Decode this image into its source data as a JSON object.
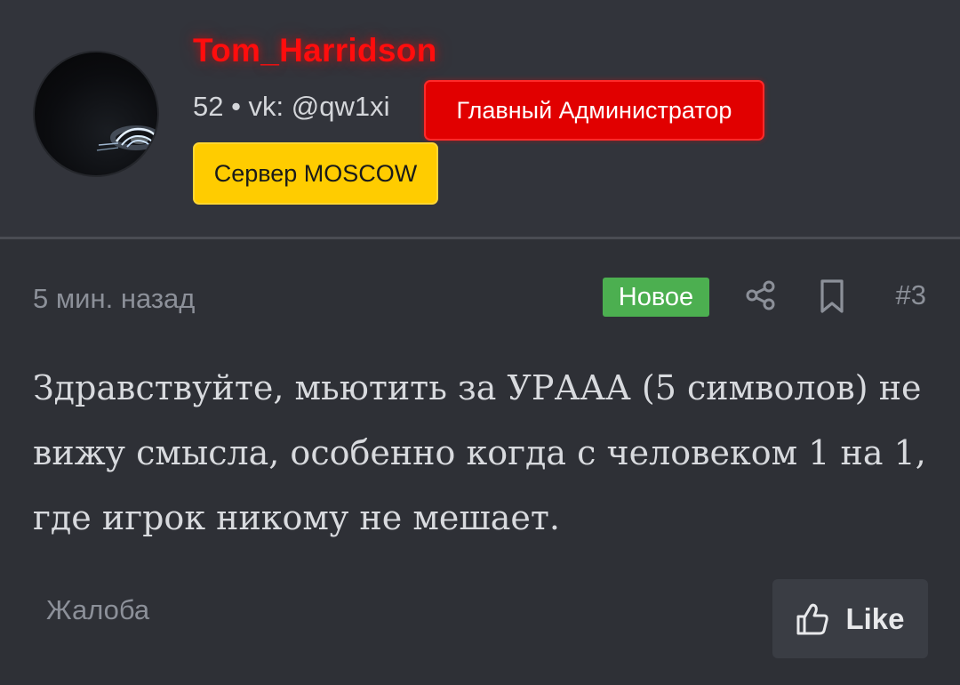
{
  "user": {
    "name": "Tom_Harridson",
    "meta": "52 • vk: @qw1xi",
    "role_badge": "Главный Администратор",
    "server_badge": "Сервер MOSCOW",
    "avatar_icon": "car-headlights-avatar"
  },
  "post": {
    "time": "5 мин. назад",
    "new_badge": "Новое",
    "share_icon": "share-icon",
    "bookmark_icon": "bookmark-icon",
    "number": "#3",
    "message": "Здравствуйте, мьютить за УРААА (5 символов) не вижу смысла, особенно когда с человеком 1 на 1, где игрок никому не мешает.",
    "complain_label": "Жалоба",
    "like_label": "Like",
    "like_icon": "thumbs-up-icon"
  },
  "colors": {
    "background": "#2f3137",
    "username": "#ff0d0d",
    "admin_badge": "#e10000",
    "server_badge": "#ffcc00",
    "new_badge": "#4caf50",
    "muted_text": "#8c9099"
  }
}
